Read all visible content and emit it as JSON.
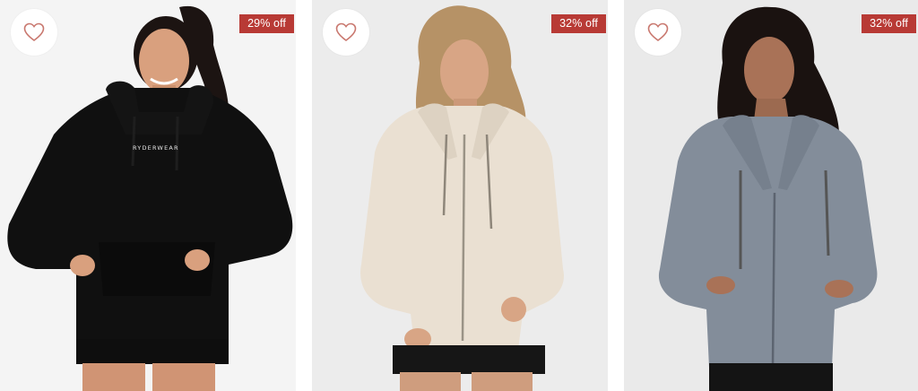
{
  "products": [
    {
      "discount": "29% off",
      "brand_print": "RYDERWEAR",
      "colors": {
        "garment": "#101010",
        "skin": "#d9a07e",
        "hair": "#1c1412"
      }
    },
    {
      "discount": "32% off",
      "colors": {
        "garment": "#eae0d2",
        "skin": "#d8a585",
        "hair": "#b69266"
      }
    },
    {
      "discount": "32% off",
      "colors": {
        "garment": "#838d9a",
        "skin": "#a97257",
        "hair": "#1a1210"
      }
    }
  ],
  "icons": {
    "wishlist": "heart-outline-icon"
  },
  "colors": {
    "accent": "#b83a35",
    "heart": "#c9786f"
  }
}
